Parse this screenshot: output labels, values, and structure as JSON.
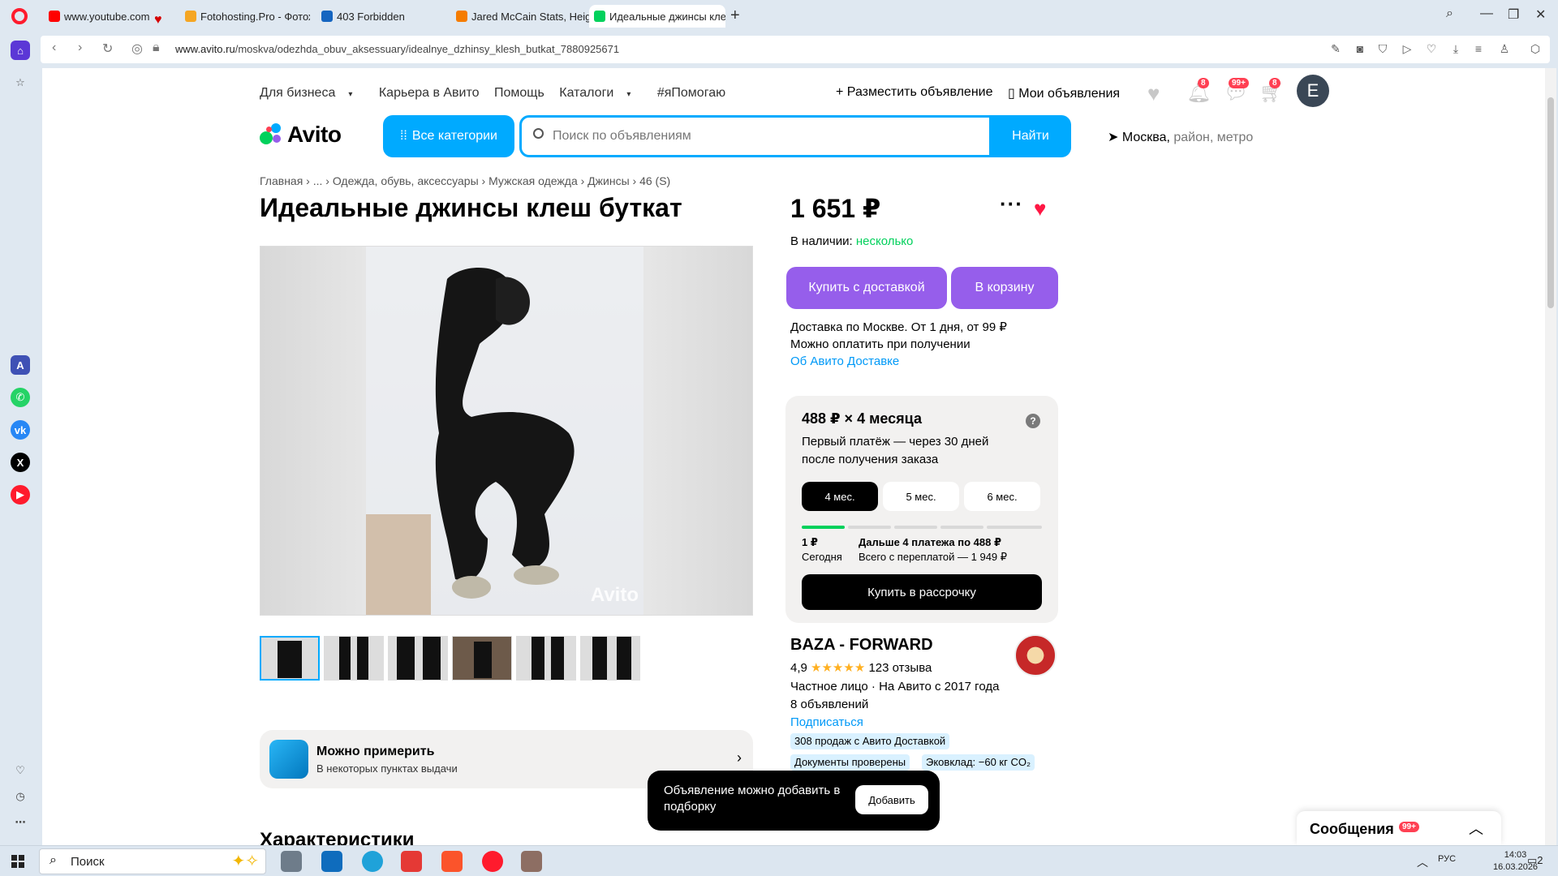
{
  "browser": {
    "tabs": [
      {
        "title": "www.youtube.com",
        "color": "#ff0000"
      },
      {
        "title": "Fotohosting.Pro - Фотохо",
        "color": "#f5a623"
      },
      {
        "title": "403 Forbidden",
        "color": "#1565c0"
      },
      {
        "title": "Jared McCain Stats, Heigh",
        "color": "#f57c00"
      },
      {
        "title": "Идеальные джинсы клеш",
        "color": "#02d15c"
      }
    ],
    "url_host": "www.avito.ru",
    "url_path": "/moskva/odezhda_obuv_aksessuary/idealnye_dzhinsy_klesh_butkat_7880925671"
  },
  "site": {
    "topnav": [
      "Для бизнеса",
      "Карьера в Авито",
      "Помощь",
      "Каталоги",
      "#яПомогаю"
    ],
    "post_ad": "Разместить объявление",
    "my_ads": "Мои объявления",
    "notif_badge": "8",
    "msg_badge": "99+",
    "cart_badge": "8",
    "avatar_letter": "E",
    "logo": "Avito",
    "all_categories": "Все категории",
    "search_placeholder": "Поиск по объявлениям",
    "search_button": "Найти",
    "location_city": "Москва,",
    "location_rest": " район, метро"
  },
  "listing": {
    "breadcrumbs": "Главная  ›  ...  ›  Одежда, обувь, аксессуары  ›  Мужская одежда  ›  Джинсы  ›  46 (S)",
    "title": "Идеальные джинсы клеш буткат",
    "watermark": "Avito",
    "tryon_title": "Можно примерить",
    "tryon_sub": "В некоторых пунктах выдачи",
    "characteristics": "Характеристики",
    "price": "1 651 ₽",
    "stock_label": "В наличии:",
    "stock_value": "несколько",
    "buy_delivery": "Купить с доставкой",
    "to_cart": "В корзину",
    "delivery_line1": "Доставка по Москве. От 1 дня, от 99 ₽",
    "delivery_line2": "Можно оплатить при получении",
    "delivery_link": "Об Авито Доставке"
  },
  "installment": {
    "heading": "488 ₽ × 4 месяца",
    "sub": "Первый платёж — через 30 дней после получения заказа",
    "options": [
      "4 мес.",
      "5 мес.",
      "6 мес."
    ],
    "first_amount": "1 ₽",
    "first_label": "Сегодня",
    "next_label": "Дальше 4 платежа по 488 ₽",
    "total_label": "Всего с переплатой — 1 949 ₽",
    "button": "Купить в рассрочку"
  },
  "seller": {
    "name": "BAZA - FORWARD",
    "rating": "4,9",
    "stars": "★★★★★",
    "reviews": "123 отзыва",
    "info": "Частное лицо · На Авито с 2017 года",
    "ads": "8 объявлений",
    "subscribe": "Подписаться",
    "tags": [
      "308 продаж с Авито Доставкой",
      "Документы проверены",
      "Эковклад: −60 кг CO₂"
    ]
  },
  "toast": {
    "text": "Объявление можно добавить в подборку",
    "button": "Добавить"
  },
  "messenger": {
    "title": "Сообщения",
    "badge": "99+"
  },
  "taskbar": {
    "search": "Поиск",
    "lang": "РУС",
    "time": "14:03",
    "date": "16.03.2026",
    "notif": "2"
  }
}
